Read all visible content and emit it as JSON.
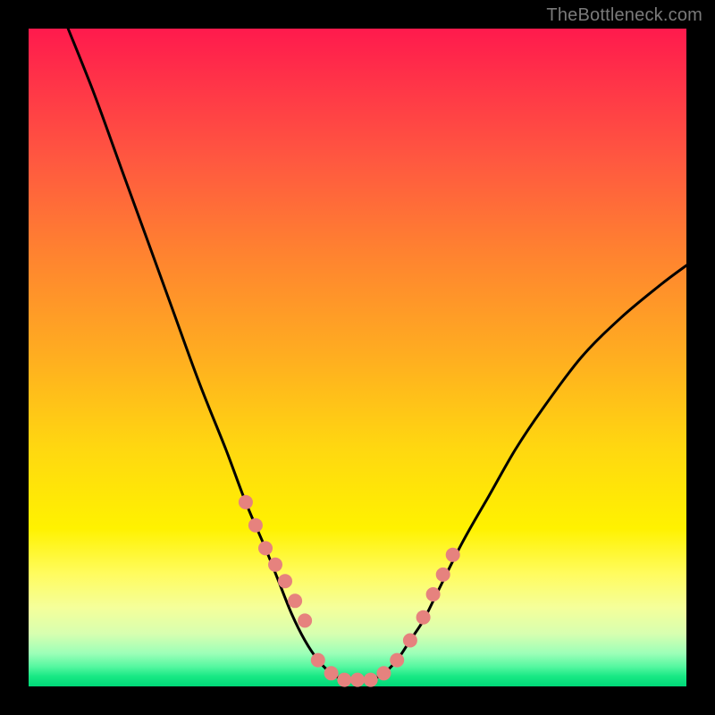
{
  "watermark": "TheBottleneck.com",
  "chart_data": {
    "type": "line",
    "title": "",
    "xlabel": "",
    "ylabel": "",
    "xlim": [
      0,
      100
    ],
    "ylim": [
      0,
      100
    ],
    "grid": false,
    "legend": false,
    "series": [
      {
        "name": "bottleneck-curve",
        "color": "#000000",
        "x": [
          6,
          10,
          14,
          18,
          22,
          26,
          30,
          33,
          36,
          38,
          40,
          42,
          44,
          46,
          48,
          50,
          52,
          54,
          56,
          58,
          60,
          62,
          66,
          70,
          74,
          78,
          84,
          90,
          96,
          100
        ],
        "y": [
          100,
          90,
          79,
          68,
          57,
          46,
          36,
          28,
          21,
          16,
          11,
          7,
          4,
          2,
          1,
          1,
          1,
          2,
          4,
          7,
          10,
          14,
          22,
          29,
          36,
          42,
          50,
          56,
          61,
          64
        ]
      },
      {
        "name": "curve-markers",
        "color": "#e6827e",
        "type": "scatter",
        "x": [
          33.0,
          34.5,
          36.0,
          37.5,
          39.0,
          40.5,
          42.0,
          44.0,
          46.0,
          48.0,
          50.0,
          52.0,
          54.0,
          56.0,
          58.0,
          60.0,
          61.5,
          63.0,
          64.5
        ],
        "y": [
          28.0,
          24.5,
          21.0,
          18.5,
          16.0,
          13.0,
          10.0,
          4.0,
          2.0,
          1.0,
          1.0,
          1.0,
          2.0,
          4.0,
          7.0,
          10.5,
          14.0,
          17.0,
          20.0
        ]
      }
    ],
    "background_gradient": {
      "direction": "top-to-bottom",
      "stops": [
        {
          "pos": 0,
          "color": "#ff1a4d"
        },
        {
          "pos": 0.5,
          "color": "#ffae20"
        },
        {
          "pos": 0.78,
          "color": "#fff200"
        },
        {
          "pos": 0.95,
          "color": "#9cffb8"
        },
        {
          "pos": 1.0,
          "color": "#00d878"
        }
      ]
    }
  }
}
